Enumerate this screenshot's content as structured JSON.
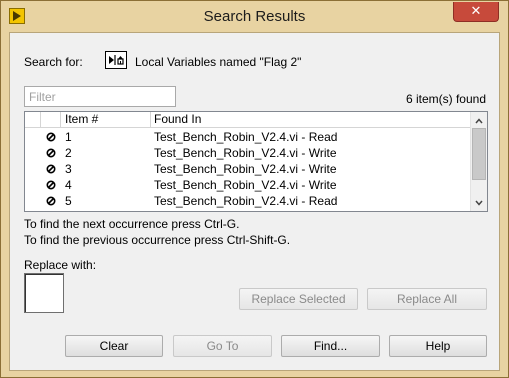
{
  "window": {
    "title": "Search Results",
    "close_symbol": "✕",
    "frame_color": "#e8d3a2",
    "close_color": "#c74a3b"
  },
  "search": {
    "label": "Search for:",
    "icon": "local-variable-icon",
    "value": "Local Variables named \"Flag 2\""
  },
  "filter": {
    "placeholder": "Filter",
    "value": ""
  },
  "results": {
    "count_text": "6 item(s) found",
    "columns": [
      "",
      "",
      "Item #",
      "Found In"
    ],
    "rows": [
      {
        "icon": "no-entry-icon",
        "item": "1",
        "found_in": "Test_Bench_Robin_V2.4.vi - Read"
      },
      {
        "icon": "no-entry-icon",
        "item": "2",
        "found_in": "Test_Bench_Robin_V2.4.vi - Write"
      },
      {
        "icon": "no-entry-icon",
        "item": "3",
        "found_in": "Test_Bench_Robin_V2.4.vi - Write"
      },
      {
        "icon": "no-entry-icon",
        "item": "4",
        "found_in": "Test_Bench_Robin_V2.4.vi - Write"
      },
      {
        "icon": "no-entry-icon",
        "item": "5",
        "found_in": "Test_Bench_Robin_V2.4.vi - Read"
      }
    ]
  },
  "hints": {
    "next": "To find the next occurrence press Ctrl-G.",
    "previous": "To find the previous occurrence press Ctrl-Shift-G."
  },
  "replace": {
    "label": "Replace with:",
    "replace_selected_label": "Replace Selected",
    "replace_all_label": "Replace All"
  },
  "buttons": {
    "clear": "Clear",
    "goto": "Go To",
    "find": "Find...",
    "help": "Help"
  }
}
